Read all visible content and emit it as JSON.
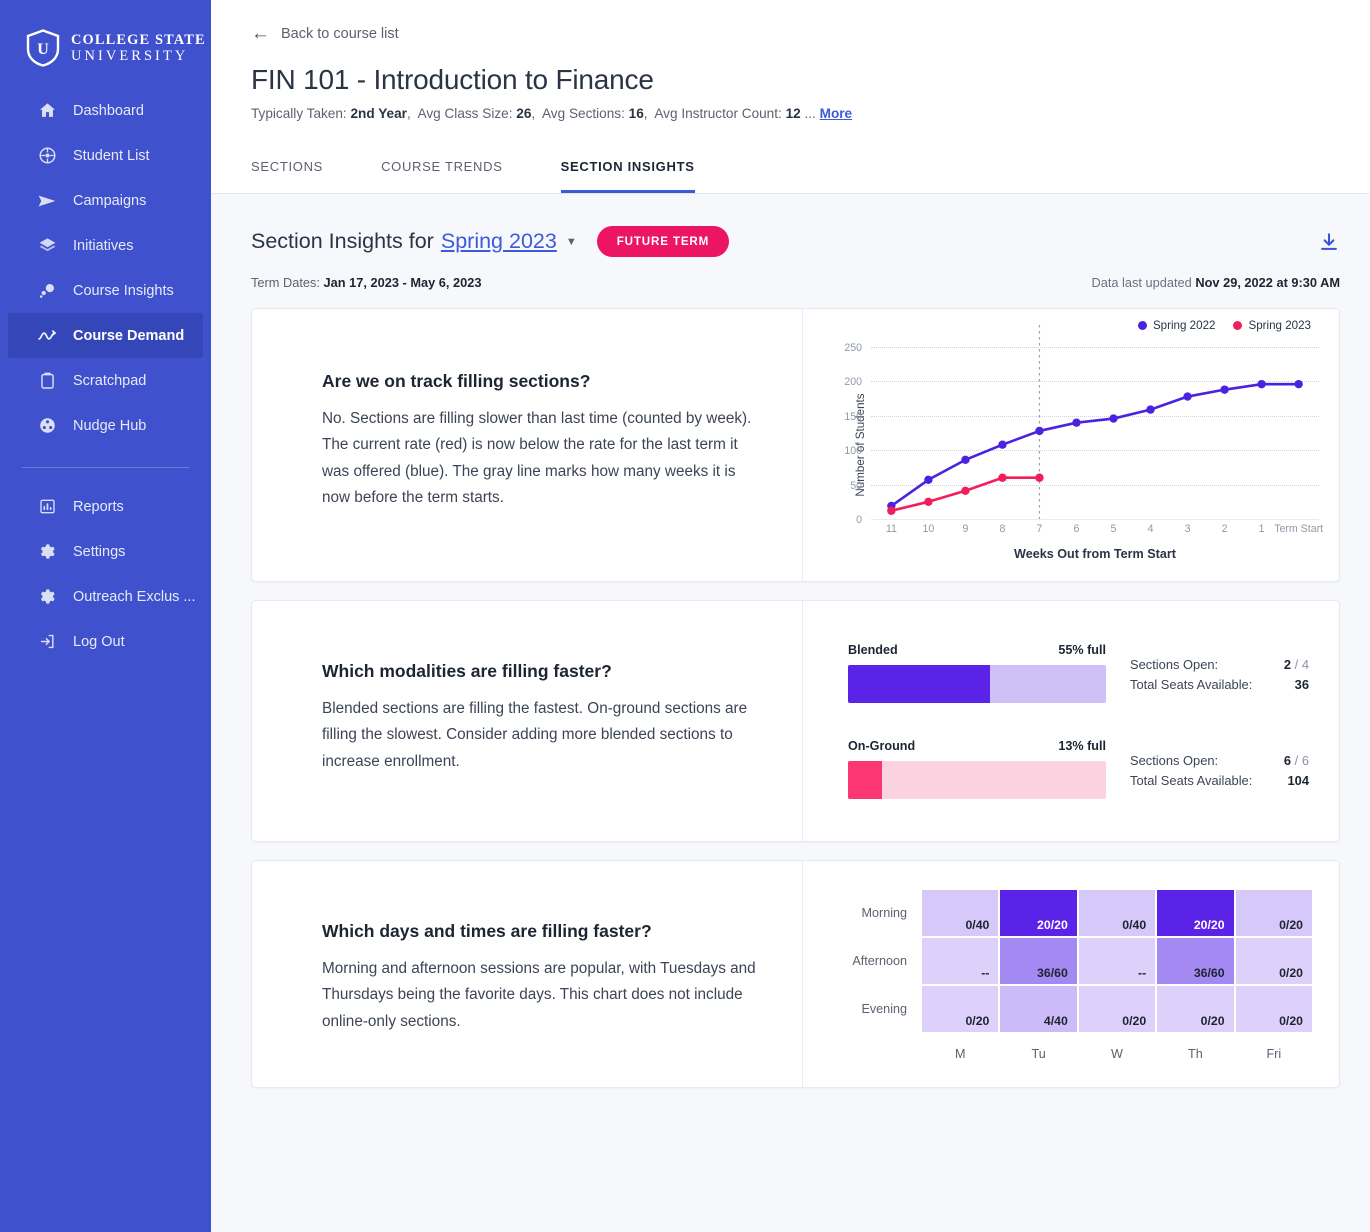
{
  "sidebar": {
    "brand": {
      "line1": "COLLEGE STATE",
      "line2": "UNIVERSITY",
      "icon": "shield-u-logo"
    },
    "items": [
      {
        "label": "Dashboard",
        "icon": "home-icon",
        "active": false
      },
      {
        "label": "Student List",
        "icon": "student-list-icon",
        "active": false
      },
      {
        "label": "Campaigns",
        "icon": "send-icon",
        "active": false
      },
      {
        "label": "Initiatives",
        "icon": "layers-icon",
        "active": false
      },
      {
        "label": "Course Insights",
        "icon": "course-insights-icon",
        "active": false
      },
      {
        "label": "Course Demand",
        "icon": "trend-icon",
        "active": true
      },
      {
        "label": "Scratchpad",
        "icon": "clipboard-icon",
        "active": false
      },
      {
        "label": "Nudge Hub",
        "icon": "nudge-icon",
        "active": false
      }
    ],
    "items_secondary": [
      {
        "label": "Reports",
        "icon": "bar-chart-icon"
      },
      {
        "label": "Settings",
        "icon": "gear-icon"
      },
      {
        "label": "Outreach Exclus ...",
        "icon": "gear-icon"
      },
      {
        "label": "Log Out",
        "icon": "logout-icon"
      }
    ]
  },
  "header": {
    "back_label": "Back to course list",
    "back_icon": "arrow-left-icon",
    "course_title": "FIN 101 - Introduction to Finance",
    "meta": {
      "typically_taken_label": "Typically Taken:",
      "typically_taken_value": "2nd Year",
      "avg_class_size_label": "Avg Class Size:",
      "avg_class_size_value": "26",
      "avg_sections_label": "Avg Sections:",
      "avg_sections_value": "16",
      "avg_instructor_label": "Avg Instructor Count:",
      "avg_instructor_value": "12",
      "ellipsis": "...",
      "more_label": "More"
    }
  },
  "tabs": [
    {
      "label": "SECTIONS",
      "active": false
    },
    {
      "label": "COURSE TRENDS",
      "active": false
    },
    {
      "label": "SECTION INSIGHTS",
      "active": true
    }
  ],
  "section": {
    "title_prefix": "Section Insights for",
    "term": "Spring 2023",
    "caret_icon": "chevron-down-icon",
    "badge": "FUTURE TERM",
    "download_icon": "download-icon",
    "term_dates_label": "Term Dates:",
    "term_dates_value": "Jan 17, 2023 -  May 6, 2023",
    "updated_label": "Data last updated",
    "updated_value": "Nov 29, 2022 at 9:30 AM"
  },
  "cards": [
    {
      "question": "Are we on track filling sections?",
      "answer": "No. Sections are filling slower than last time (counted by week). The current rate (red) is now below the rate for the last term it was offered (blue). The gray line marks how many weeks it is now before the term starts."
    },
    {
      "question": "Which modalities are filling faster?",
      "answer": "Blended sections are filling the fastest. On-ground sections are filling the slowest. Consider adding more blended sections to increase enrollment."
    },
    {
      "question": "Which days and times are filling faster?",
      "answer": "Morning and afternoon sessions are popular, with Tuesdays and Thursdays being the favorite days. This chart does not include online-only sections."
    }
  ],
  "colors": {
    "sidebar": "#3f51cc",
    "sidebar_active": "#3547b8",
    "accent_blue": "#3b5bdb",
    "accent_pink": "#ec1464",
    "series_blue": "#4b22e0",
    "series_red": "#f01e5a",
    "bar_blended_fill": "#5b22e8",
    "bar_blended_track": "#cfc0f7",
    "bar_onground_fill": "#fb3670",
    "bar_onground_track": "#fbd3e0"
  },
  "chart_data": [
    {
      "type": "line",
      "title": "",
      "xlabel": "Weeks Out from Term Start",
      "ylabel": "Number of Students",
      "x": [
        "11",
        "10",
        "9",
        "8",
        "7",
        "6",
        "5",
        "4",
        "3",
        "2",
        "1",
        "Term Start"
      ],
      "ylim": [
        0,
        250
      ],
      "yticks": [
        0,
        50,
        100,
        150,
        200,
        250
      ],
      "grid": true,
      "legend_position": "top-right",
      "annotations": [
        {
          "type": "vline",
          "at": "7",
          "style": "gray dotted",
          "label": "current week marker"
        }
      ],
      "series": [
        {
          "name": "Spring 2022",
          "color": "#4b22e0",
          "values": [
            19,
            57,
            86,
            108,
            128,
            140,
            146,
            159,
            178,
            188,
            196,
            196
          ]
        },
        {
          "name": "Spring 2023",
          "color": "#f01e5a",
          "values": [
            12,
            25,
            41,
            60,
            60,
            null,
            null,
            null,
            null,
            null,
            null,
            null
          ]
        }
      ]
    },
    {
      "type": "bar",
      "orientation": "horizontal",
      "title": "",
      "rows": [
        {
          "label": "Blended",
          "percent_label": "55% full",
          "percent": 55,
          "fill_color": "#5b22e8",
          "track_color": "#cfc0f7",
          "stats": [
            {
              "label": "Sections Open:",
              "value": "2",
              "denominator": "/ 4"
            },
            {
              "label": "Total Seats Available:",
              "value": "36",
              "denominator": ""
            }
          ]
        },
        {
          "label": "On-Ground",
          "percent_label": "13% full",
          "percent": 13,
          "fill_color": "#fb3670",
          "track_color": "#fbd3e0",
          "stats": [
            {
              "label": "Sections Open:",
              "value": "6",
              "denominator": "/ 6"
            },
            {
              "label": "Total Seats Available:",
              "value": "104",
              "denominator": ""
            }
          ]
        }
      ]
    },
    {
      "type": "heatmap",
      "title": "",
      "xlabel": "",
      "ylabel": "",
      "columns": [
        "M",
        "Tu",
        "W",
        "Th",
        "Fri"
      ],
      "rows": [
        "Morning",
        "Afternoon",
        "Evening"
      ],
      "cells": [
        [
          {
            "text": "0/40",
            "filled": 0,
            "capacity": 40,
            "ratio": 0.0,
            "bg": "#d7c8fa",
            "fg": "#1d2533"
          },
          {
            "text": "20/20",
            "filled": 20,
            "capacity": 20,
            "ratio": 1.0,
            "bg": "#5b22e8",
            "fg": "#ffffff"
          },
          {
            "text": "0/40",
            "filled": 0,
            "capacity": 40,
            "ratio": 0.0,
            "bg": "#d7c8fa",
            "fg": "#1d2533"
          },
          {
            "text": "20/20",
            "filled": 20,
            "capacity": 20,
            "ratio": 1.0,
            "bg": "#5b22e8",
            "fg": "#ffffff"
          },
          {
            "text": "0/20",
            "filled": 0,
            "capacity": 20,
            "ratio": 0.0,
            "bg": "#d7c8fa",
            "fg": "#1d2533"
          }
        ],
        [
          {
            "text": "--",
            "filled": null,
            "capacity": null,
            "ratio": null,
            "bg": "#ddd0fb",
            "fg": "#1d2533"
          },
          {
            "text": "36/60",
            "filled": 36,
            "capacity": 60,
            "ratio": 0.6,
            "bg": "#a489f3",
            "fg": "#1d2533"
          },
          {
            "text": "--",
            "filled": null,
            "capacity": null,
            "ratio": null,
            "bg": "#ddd0fb",
            "fg": "#1d2533"
          },
          {
            "text": "36/60",
            "filled": 36,
            "capacity": 60,
            "ratio": 0.6,
            "bg": "#a489f3",
            "fg": "#1d2533"
          },
          {
            "text": "0/20",
            "filled": 0,
            "capacity": 20,
            "ratio": 0.0,
            "bg": "#ddd0fb",
            "fg": "#1d2533"
          }
        ],
        [
          {
            "text": "0/20",
            "filled": 0,
            "capacity": 20,
            "ratio": 0.0,
            "bg": "#ddd0fb",
            "fg": "#1d2533"
          },
          {
            "text": "4/40",
            "filled": 4,
            "capacity": 40,
            "ratio": 0.1,
            "bg": "#cdbaf9",
            "fg": "#1d2533"
          },
          {
            "text": "0/20",
            "filled": 0,
            "capacity": 20,
            "ratio": 0.0,
            "bg": "#ddd0fb",
            "fg": "#1d2533"
          },
          {
            "text": "0/20",
            "filled": 0,
            "capacity": 20,
            "ratio": 0.0,
            "bg": "#ddd0fb",
            "fg": "#1d2533"
          },
          {
            "text": "0/20",
            "filled": 0,
            "capacity": 20,
            "ratio": 0.0,
            "bg": "#ddd0fb",
            "fg": "#1d2533"
          }
        ]
      ]
    }
  ]
}
